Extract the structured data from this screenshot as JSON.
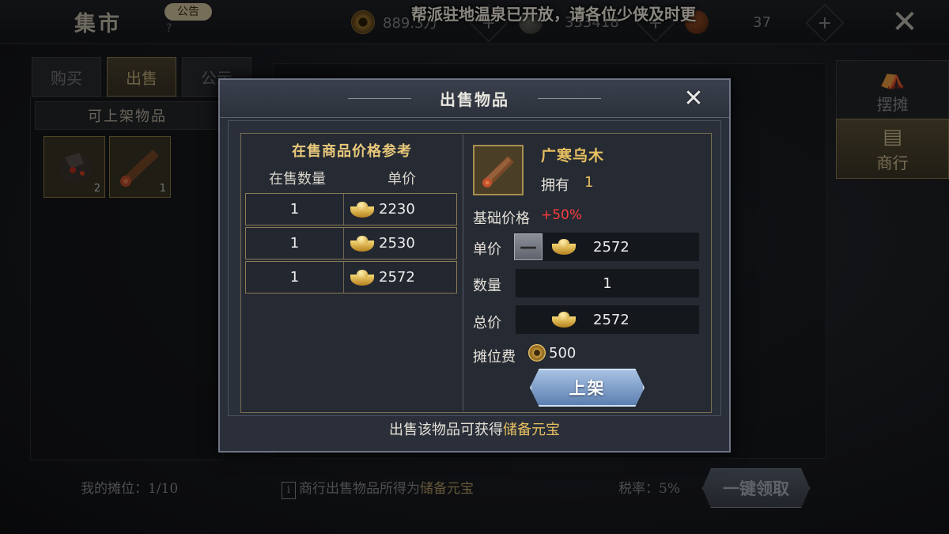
{
  "header": {
    "title": "集市",
    "notice_badge": "公告",
    "help_mark": "?",
    "currencies": [
      {
        "icon": "coin-icon",
        "value": "889.3万"
      },
      {
        "icon": "ore-icon",
        "value": "333418"
      },
      {
        "icon": "token-icon",
        "value": "37"
      }
    ],
    "plus_label": "+",
    "marquee": "帮派驻地温泉已开放，请各位少侠及时更",
    "close_label": "✕"
  },
  "left_tabs": [
    {
      "label": "购买",
      "active": false
    },
    {
      "label": "出售",
      "active": true
    },
    {
      "label": "公示",
      "active": false
    }
  ],
  "inventory": {
    "header": "可上架物品",
    "slots": [
      {
        "icon": "ore-chunk-icon",
        "count": "2"
      },
      {
        "icon": "wood-log-icon",
        "count": "1"
      }
    ]
  },
  "side_tabs": [
    {
      "icon": "stall-icon",
      "label": "摆摊",
      "active": false
    },
    {
      "icon": "trade-house-icon",
      "label": "商行",
      "active": true
    }
  ],
  "bottom": {
    "my_stall": "我的摊位：1/10",
    "info_icon": "i",
    "info_text_prefix": "商行出售物品所得为",
    "info_text_highlight": "储备元宝",
    "tax": "税率：5%",
    "claim_button": "一键领取"
  },
  "modal": {
    "title": "出售物品",
    "close_label": "✕",
    "reference": {
      "title": "在售商品价格参考",
      "col_qty": "在售数量",
      "col_price": "单价",
      "rows": [
        {
          "qty": "1",
          "price": "2230"
        },
        {
          "qty": "1",
          "price": "2530"
        },
        {
          "qty": "1",
          "price": "2572"
        }
      ]
    },
    "item": {
      "name": "广寒乌木",
      "own_label": "拥有",
      "own_value": "1",
      "base_price_label": "基础价格",
      "base_price_bonus": "+50%",
      "unit_price_label": "单价",
      "minus_label": "—",
      "unit_price_value": "2572",
      "quantity_label": "数量",
      "quantity_value": "1",
      "total_label": "总价",
      "total_value": "2572",
      "fee_label": "摊位费",
      "fee_value": "500"
    },
    "list_button": "上架",
    "footer_prefix": "出售该物品可获得",
    "footer_highlight": "储备元宝"
  }
}
